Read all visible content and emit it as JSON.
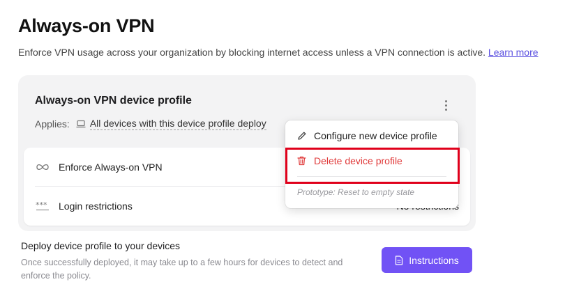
{
  "page": {
    "title": "Always-on VPN",
    "description": "Enforce VPN usage across your organization by blocking internet access unless a VPN connection is active.",
    "learn_more": "Learn more"
  },
  "profile": {
    "title": "Always-on VPN device profile",
    "applies_label": "Applies:",
    "applies_target": "All devices with this device profile deploy",
    "applies_icon": "laptop-icon",
    "menu_icon": "more-vertical-icon"
  },
  "settings": [
    {
      "label": "Enforce Always-on VPN",
      "value": "",
      "icon": "infinity-icon"
    },
    {
      "label": "Login restrictions",
      "value": "No restrictions",
      "icon": "password-icon"
    }
  ],
  "context_menu": {
    "items": [
      {
        "label": "Configure new device profile",
        "icon": "pencil-icon"
      },
      {
        "label": "Delete device profile",
        "icon": "trash-icon"
      }
    ],
    "note": "Prototype: Reset to empty state"
  },
  "deploy": {
    "title": "Deploy device profile to your devices",
    "description": "Once successfully deployed, it may take up to a few hours for devices to detect and enforce the policy.",
    "button_label": "Instructions",
    "button_icon": "document-icon"
  },
  "colors": {
    "accent": "#7152f5",
    "danger": "#e03a3a",
    "link": "#5a4fe0",
    "highlight": "#e0001b"
  }
}
